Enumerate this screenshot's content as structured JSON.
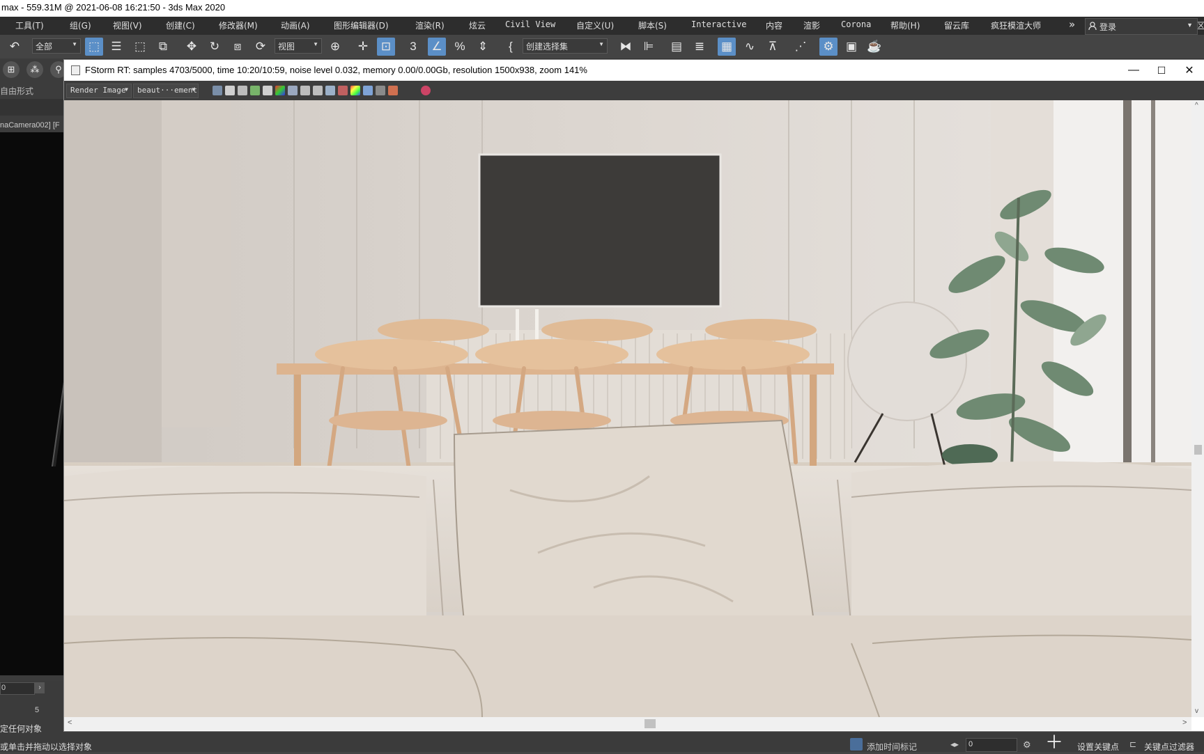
{
  "app": {
    "title": "max - 559.31M @ 2021-06-08 16:21:50 - 3ds Max 2020"
  },
  "menu": {
    "items": [
      "工具(T)",
      "组(G)",
      "视图(V)",
      "创建(C)",
      "修改器(M)",
      "动画(A)",
      "图形编辑器(D)",
      "渲染(R)",
      "炫云",
      "Civil View",
      "自定义(U)",
      "脚本(S)",
      "Interactive",
      "内容",
      "渲影",
      "Corona",
      "帮助(H)",
      "留云库",
      "疯狂模渲大师"
    ],
    "overflow": "»",
    "login": "登录",
    "workspace": "工作区"
  },
  "toolbar": {
    "filter_dropdown": "全部",
    "view_dropdown": "视图",
    "selection_set": "创建选择集"
  },
  "left": {
    "freeform_label": "自由形式",
    "viewport_label": "naCamera002] [F",
    "frame_input": "0",
    "tick_label": "5"
  },
  "status": {
    "line1": "定任何对象",
    "line2": "或单击并拖动以选择对象",
    "add_time_tag": "添加时间标记",
    "frame_value": "0",
    "set_key": "设置关键点",
    "key_filter": "关键点过滤器"
  },
  "frame_window": {
    "title": "FStorm RT: samples 4703/5000,  time 10:20/10:59,  noise level 0.032,  memory 0.00/0.00Gb,  resolution 1500x938,  zoom 141%",
    "render_mode": "Render Image",
    "element": "beaut···ement",
    "minimize": "—",
    "maximize": "☐",
    "close": "✕",
    "scroll_left": "<",
    "scroll_right": ">",
    "scroll_up": "^",
    "scroll_down": "v"
  }
}
